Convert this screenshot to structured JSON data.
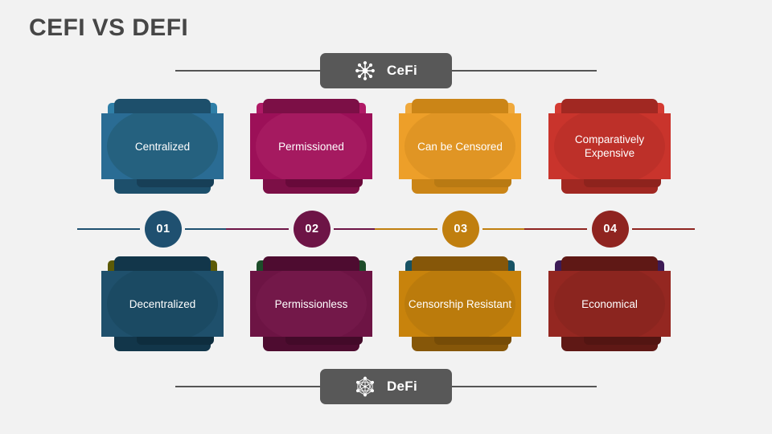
{
  "page": {
    "title": "CEFI VS DEFI",
    "background": "#f2f2f2",
    "title_color": "#464646"
  },
  "header_badge": {
    "label": "CeFi",
    "icon": "centralized-network-icon",
    "background": "#585858",
    "line_color": "#555555"
  },
  "footer_badge": {
    "label": "DeFi",
    "icon": "distributed-network-icon",
    "background": "#585858",
    "line_color": "#555555"
  },
  "columns": [
    {
      "step_number": "01",
      "accent": "#1f5070",
      "top_card": {
        "label": "Centralized",
        "front": "#2a6c94",
        "oval": "#25617f",
        "back": "#1d4f6b",
        "back_inner": "#173f57",
        "sliver": "#2f7fa8"
      },
      "bottom_card": {
        "label": "Decentralized",
        "front": "#1f506c",
        "oval": "#1b4a63",
        "back": "#12364a",
        "back_inner": "#0e2d3e",
        "sliver": "#5c5a06"
      }
    },
    {
      "step_number": "02",
      "accent": "#6d1446",
      "top_card": {
        "label": "Permissioned",
        "front": "#9c1058",
        "oval": "#a51a60",
        "back": "#7c0f46",
        "back_inner": "#68093a",
        "sliver": "#b01a66"
      },
      "bottom_card": {
        "label": "Permissionless",
        "front": "#6d1444",
        "oval": "#731849",
        "back": "#4e0c30",
        "back_inner": "#430a29",
        "sliver": "#1d4d2a"
      }
    },
    {
      "step_number": "03",
      "accent": "#c07f0f",
      "top_card": {
        "label": "Can be Censored",
        "front": "#ed9f29",
        "oval": "#e09524",
        "back": "#cb8517",
        "back_inner": "#b97a13",
        "sliver": "#f0a93c"
      },
      "bottom_card": {
        "label": "Censorship Resistant",
        "front": "#c8830c",
        "oval": "#bb7b0c",
        "back": "#865709",
        "back_inner": "#764c07",
        "sliver": "#175264"
      }
    },
    {
      "step_number": "04",
      "accent": "#8f2420",
      "top_card": {
        "label": "Comparatively Expensive",
        "front": "#c9342c",
        "oval": "#bd3029",
        "back": "#a12822",
        "back_inner": "#8e231d",
        "sliver": "#d43b32"
      },
      "bottom_card": {
        "label": "Economical",
        "front": "#942721",
        "oval": "#8b251f",
        "back": "#5f1815",
        "back_inner": "#531512",
        "sliver": "#3c1a55"
      }
    }
  ]
}
